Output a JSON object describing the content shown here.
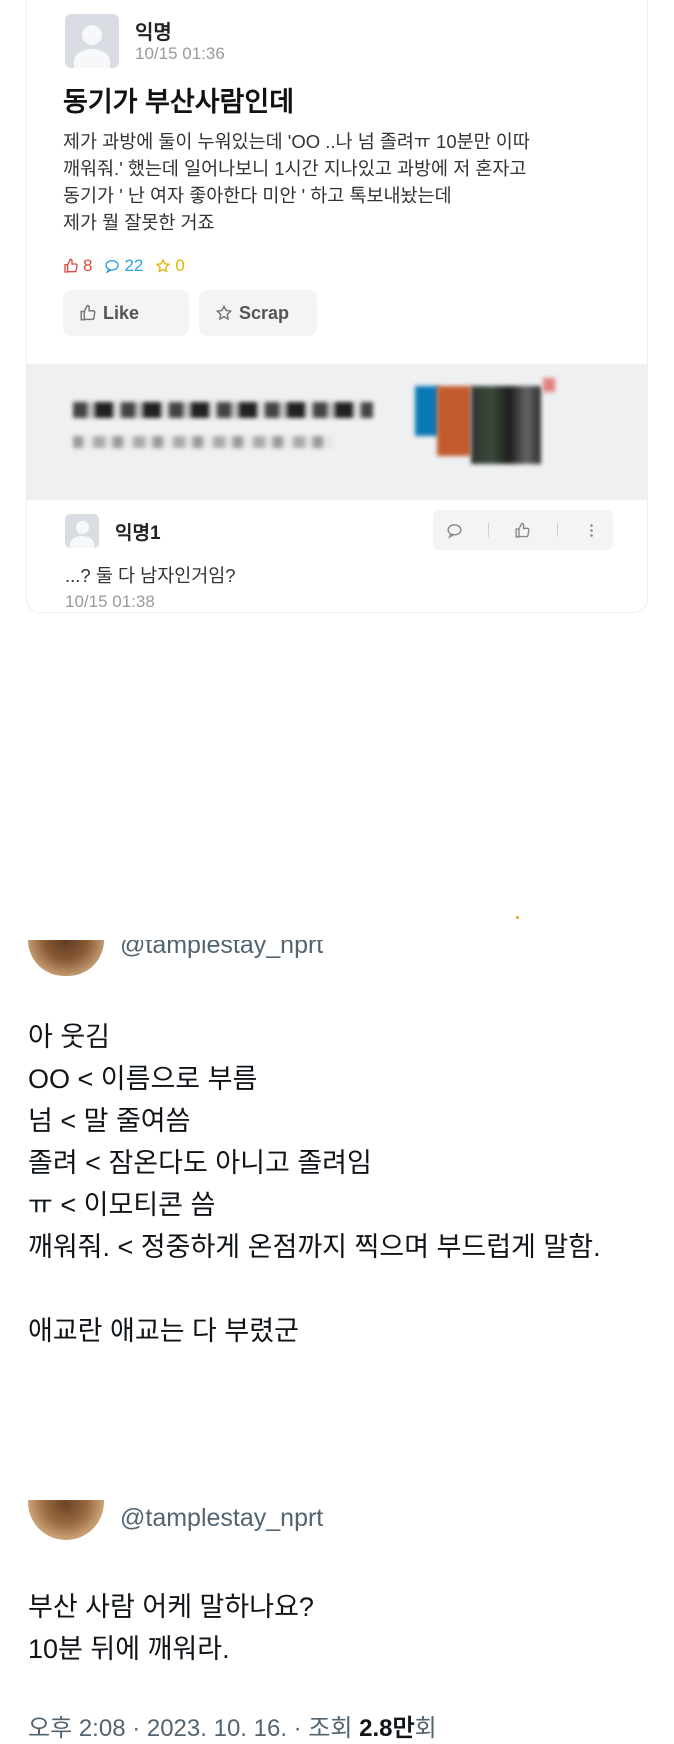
{
  "post": {
    "author": "익명",
    "time": "10/15 01:36",
    "title": "동기가 부산사람인데",
    "body_lines": [
      "제가 과방에 둘이 누워있는데 'OO ..나 넘 졸려ㅠ 10분만 이따",
      "깨워줘.' 했는데 일어나보니 1시간 지나있고 과방에 저 혼자고",
      "동기가 ' 난 여자 좋아한다 미안 ' 하고 톡보내놨는데",
      "제가 뭘 잘못한 거죠"
    ],
    "likes": "8",
    "comments": "22",
    "scraps": "0",
    "like_label": "Like",
    "scrap_label": "Scrap"
  },
  "comment": {
    "author": "익명1",
    "text": "...? 둘 다 남자인거임?",
    "time": "10/15 01:38"
  },
  "tweet1": {
    "handle": "@tamplestay_nprt",
    "lines": [
      "아 웃김",
      "OO < 이름으로 부름",
      "넘 < 말 줄여씀",
      "졸려 < 잠온다도 아니고 졸려임",
      "ㅠ < 이모티콘 씀",
      "깨워줘. < 정중하게 온점까지 찍으며 부드럽게 말함.",
      "",
      "애교란 애교는 다 부렸군"
    ]
  },
  "tweet2": {
    "handle": "@tamplestay_nprt",
    "lines": [
      "부산 사람 어케 말하나요?",
      "10분 뒤에 깨워라."
    ],
    "meta_time": "오후 2:08 · 2023. 10. 16. · 조회 ",
    "meta_views": "2.8만",
    "meta_suffix": "회"
  },
  "colors": {
    "like_red": "#d84b3e",
    "comment_blue": "#2d9ee0",
    "scrap_yellow": "#e5b100",
    "twitter_gray": "#536471"
  },
  "icons": [
    "thumbs-up-icon",
    "comment-bubble-icon",
    "star-icon",
    "more-vertical-icon"
  ]
}
